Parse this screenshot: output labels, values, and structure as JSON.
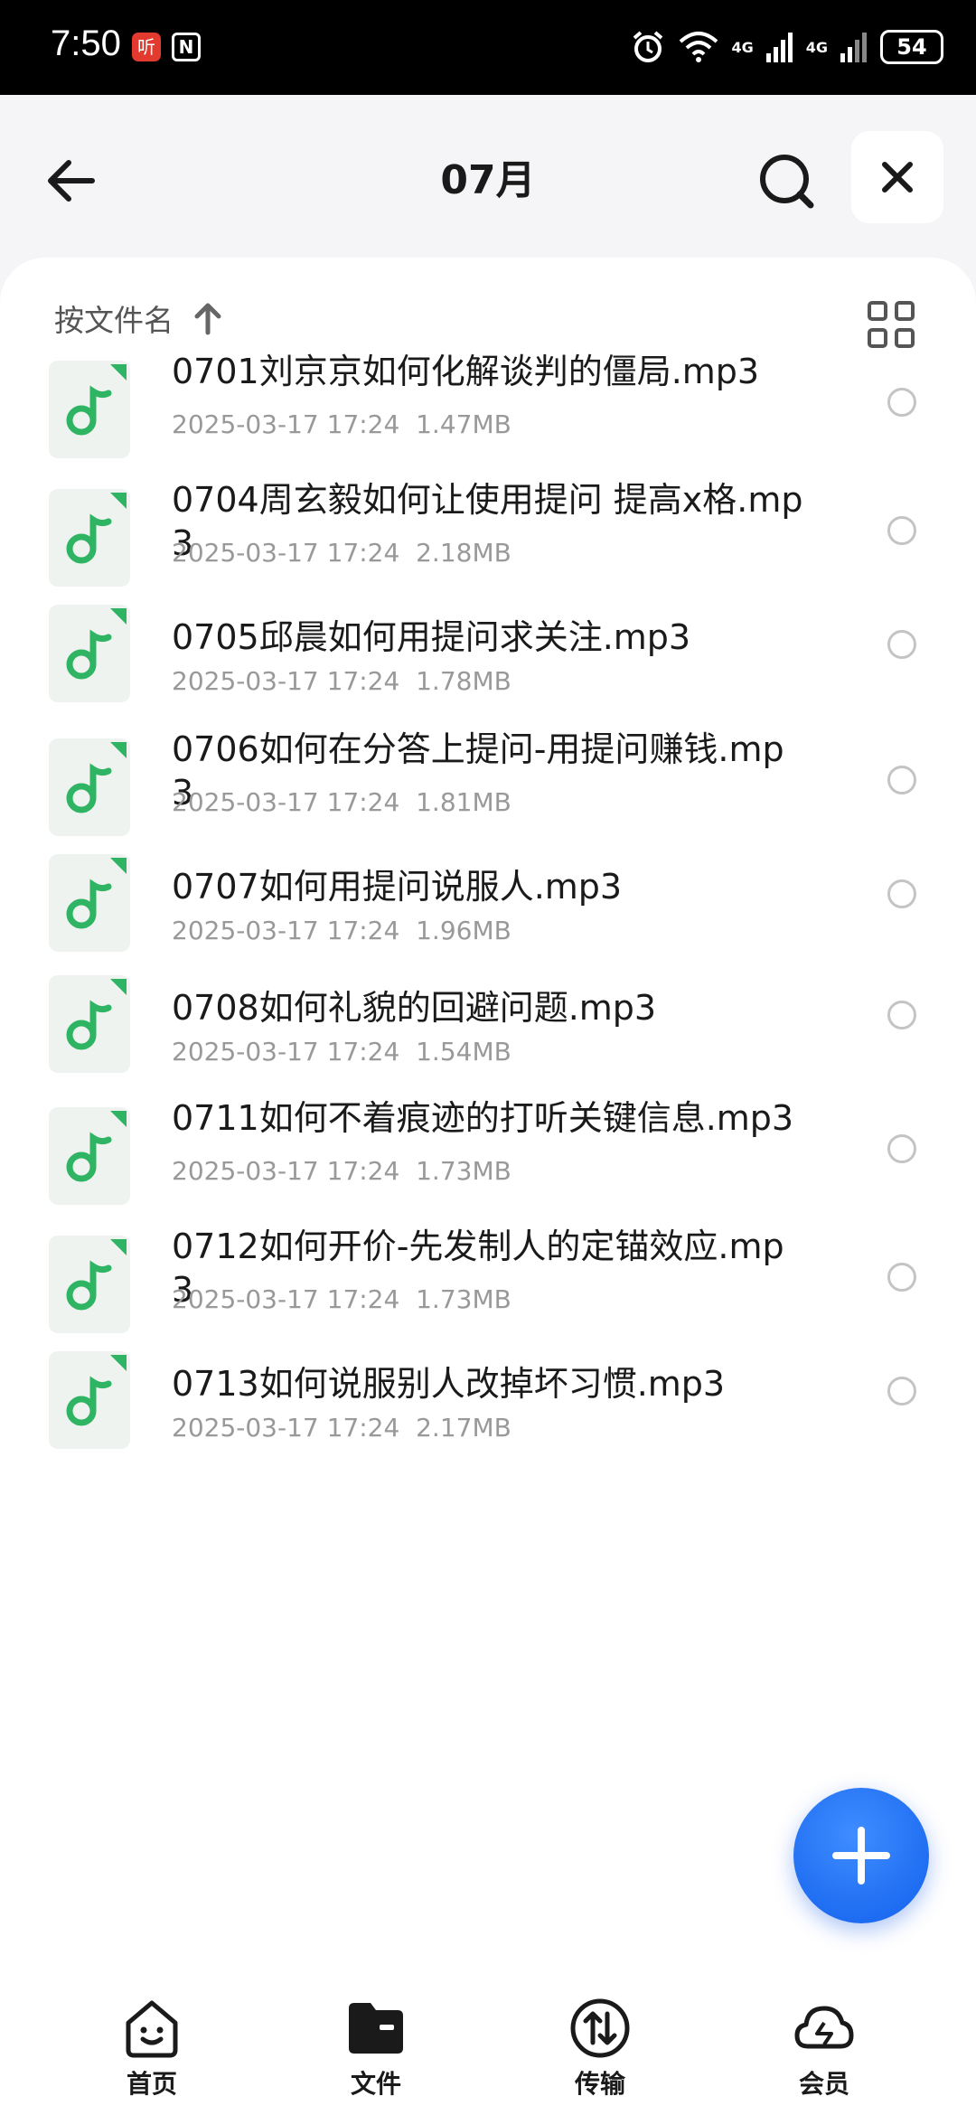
{
  "status_bar": {
    "time": "7:50",
    "app_badge_1": "听",
    "app_badge_2": "N",
    "network_1": "4G",
    "network_2": "4G",
    "battery": "54"
  },
  "header": {
    "title": "07月"
  },
  "sort": {
    "label": "按文件名"
  },
  "files": [
    {
      "name": "0701刘京京如何化解谈判的僵局.mp3",
      "meta": "2025-03-17 17:24  1.47MB"
    },
    {
      "name": "0704周玄毅如何让使用提问 提高x格.mp3",
      "meta": "2025-03-17 17:24  2.18MB"
    },
    {
      "name": "0705邱晨如何用提问求关注.mp3",
      "meta": "2025-03-17 17:24  1.78MB"
    },
    {
      "name": "0706如何在分答上提问-用提问赚钱.mp3",
      "meta": "2025-03-17 17:24  1.81MB"
    },
    {
      "name": "0707如何用提问说服人.mp3",
      "meta": "2025-03-17 17:24  1.96MB"
    },
    {
      "name": "0708如何礼貌的回避问题.mp3",
      "meta": "2025-03-17 17:24  1.54MB"
    },
    {
      "name": "0711如何不着痕迹的打听关键信息.mp3",
      "meta": "2025-03-17 17:24  1.73MB"
    },
    {
      "name": "0712如何开价-先发制人的定锚效应.mp3",
      "meta": "2025-03-17 17:24  1.73MB"
    },
    {
      "name": "0713如何说服别人改掉坏习惯.mp3",
      "meta": "2025-03-17 17:24  2.17MB"
    }
  ],
  "bottom_nav": {
    "home": "首页",
    "files": "文件",
    "transfer": "传输",
    "member": "会员"
  },
  "colors": {
    "accent_blue": "#1a6cf0",
    "music_green": "#2fb463",
    "meta_gray": "#999999"
  }
}
